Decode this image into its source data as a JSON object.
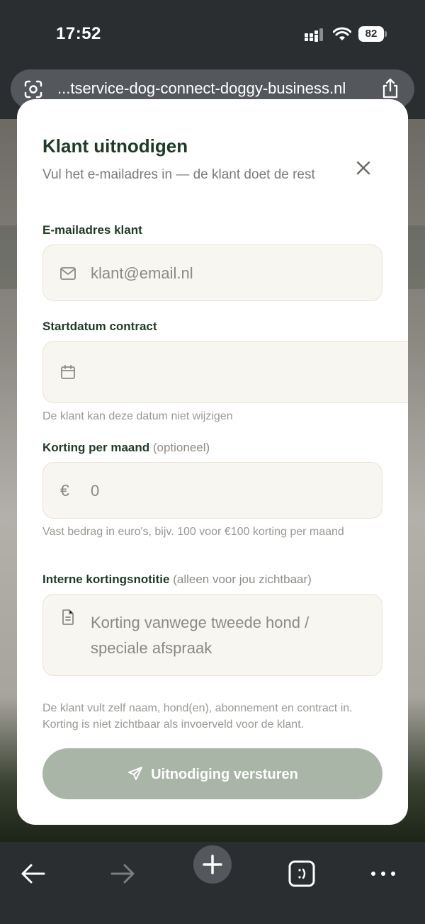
{
  "status_bar": {
    "time": "17:52",
    "battery": "82"
  },
  "browser": {
    "url": "...tservice-dog-connect-doggy-business.nl"
  },
  "modal": {
    "title": "Klant uitnodigen",
    "subtitle": "Vul het e-mailadres in — de klant doet de rest",
    "email": {
      "label": "E-mailadres klant",
      "placeholder": "klant@email.nl"
    },
    "start_date": {
      "label": "Startdatum contract",
      "value": "",
      "helper": "De klant kan deze datum niet wijzigen"
    },
    "discount": {
      "label": "Korting per maand",
      "optional": "(optioneel)",
      "currency": "€",
      "placeholder": "0",
      "helper": "Vast bedrag in euro's, bijv. 100 voor €100 korting per maand"
    },
    "note": {
      "label": "Interne kortingsnotitie",
      "optional": "(alleen voor jou zichtbaar)",
      "placeholder": "Korting vanwege tweede hond / speciale afspraak"
    },
    "footer_note": "De klant vult zelf naam, hond(en), abonnement en contract in. Korting is niet zichtbaar als invoerveld voor de klant.",
    "submit_label": "Uitnodiging versturen"
  },
  "colors": {
    "brand_dark_green": "#1f3a26",
    "button_disabled": "#a9b5a7",
    "field_bg": "#f8f6f1",
    "field_border": "#ece2d6"
  },
  "icons": [
    "mail-icon",
    "calendar-icon",
    "euro-icon",
    "document-icon",
    "send-icon",
    "close-icon",
    "back-icon",
    "forward-icon",
    "new-tab-icon",
    "tabs-icon",
    "more-icon",
    "share-icon",
    "lens-icon"
  ]
}
